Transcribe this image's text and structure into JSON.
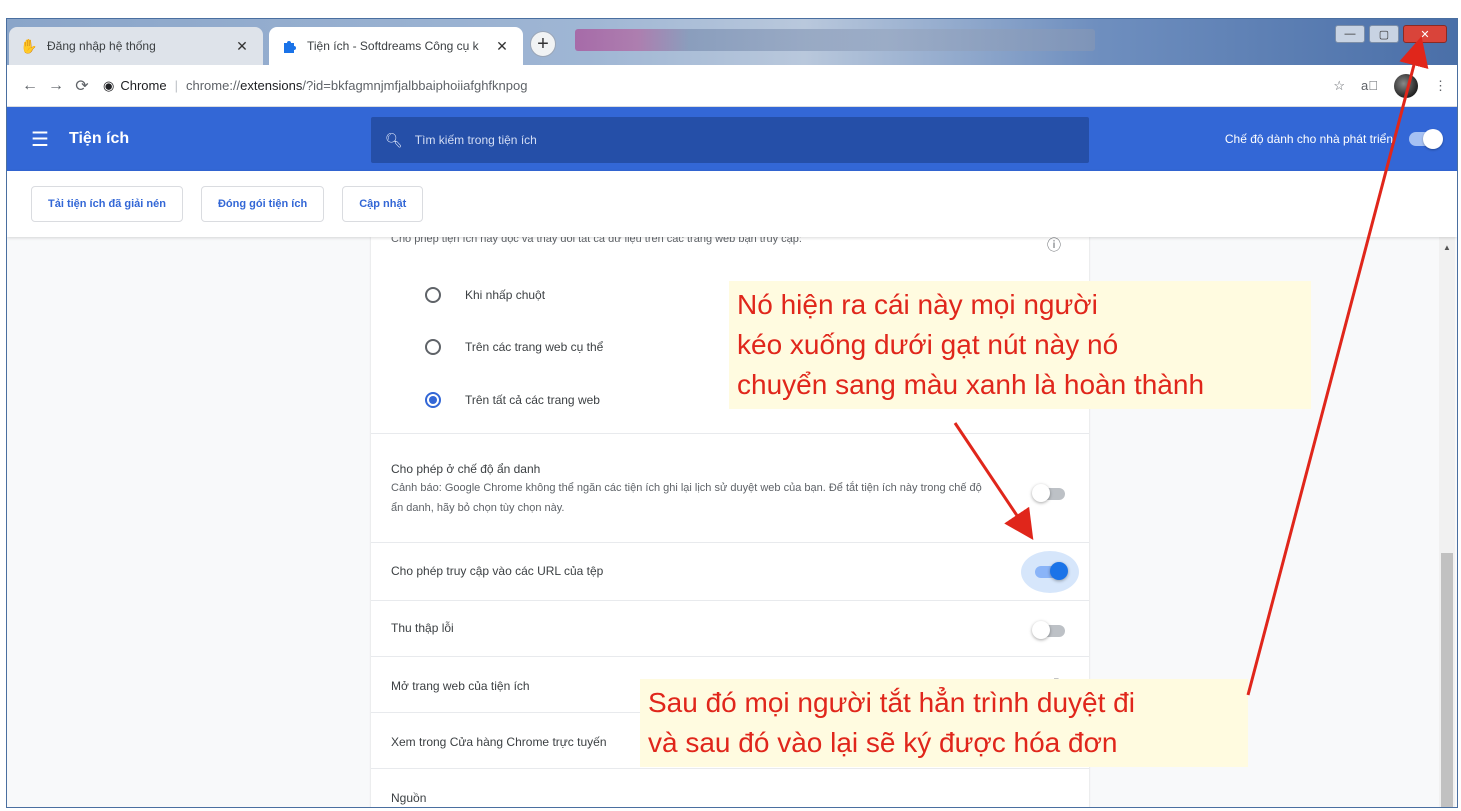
{
  "tabs": [
    {
      "title": "Đăng nhập hệ thống",
      "favicon": "hand-icon"
    },
    {
      "title": "Tiện ích - Softdreams Công cụ k",
      "favicon": "puzzle-icon"
    }
  ],
  "address": {
    "origin_label": "Chrome",
    "url_prefix": "chrome://",
    "url_bold": "extensions",
    "url_suffix": "/?id=bkfagmnjmfjalbbaiphoiiafghfknpog"
  },
  "header": {
    "title": "Tiện ích",
    "search_placeholder": "Tìm kiếm trong tiện ích",
    "dev_mode_label": "Chế độ dành cho nhà phát triển",
    "dev_mode_on": true
  },
  "actions": [
    "Tải tiện ích đã giải nén",
    "Đóng gói tiện ích",
    "Cập nhật"
  ],
  "site_access": {
    "options": [
      "Khi nhấp chuột",
      "Trên các trang web cụ thể",
      "Trên tất cả các trang web"
    ],
    "selected": "Trên tất cả các trang web"
  },
  "settings": {
    "incognito_label": "Cho phép ở chế độ ẩn danh",
    "incognito_warning": "Cảnh báo: Google Chrome không thể ngăn các tiện ích ghi lại lịch sử duyệt web của bạn. Để tắt tiện ích này trong chế độ ẩn danh, hãy bỏ chọn tùy chọn này.",
    "file_urls_label": "Cho phép truy cập vào các URL của tệp",
    "file_urls_on": true,
    "collect_errors_label": "Thu thập lỗi",
    "website_label": "Mở trang web của tiện ích",
    "store_label": "Xem trong Cửa hàng Chrome trực tuyến",
    "source_label": "Nguồn"
  },
  "annotations": {
    "note1": [
      "Nó hiện ra cái này mọi người",
      "kéo xuống dưới gạt nút này nó",
      "chuyển sang màu xanh là hoàn thành"
    ],
    "note2": [
      "Sau đó mọi người tắt hẳn trình duyệt đi",
      "và sau đó vào lại sẽ ký được hóa đơn"
    ],
    "color": "#e0261b"
  },
  "colors": {
    "header_blue": "#3367d6",
    "toggle_blue": "#1a73e8"
  }
}
